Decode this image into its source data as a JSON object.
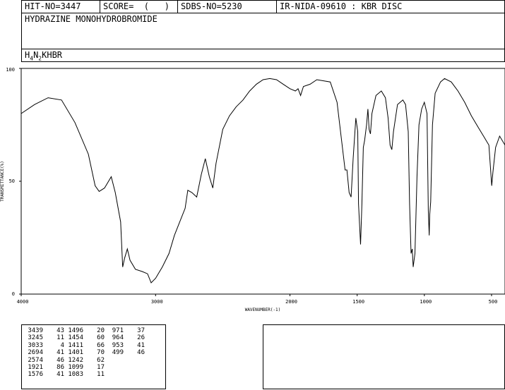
{
  "header": {
    "hit_no": "HIT-NO=3447",
    "score": "SCORE=  (   )",
    "sdbs_no": "SDBS-NO=5230",
    "ir_id": "IR-NIDA-09610 : KBR DISC"
  },
  "compound": {
    "name": "HYDRAZINE MONOHYDROBROMIDE",
    "formula_parts": [
      "H",
      "4",
      "N",
      "2",
      "KHBR"
    ]
  },
  "chart_data": {
    "type": "line",
    "title": "",
    "xlabel": "WAVENUMBER(-1)",
    "ylabel": "TRANSMITTANCE(%)",
    "xlim": [
      4000,
      400
    ],
    "ylim": [
      0,
      100
    ],
    "x_ticks": [
      "4000",
      "3000",
      "2000",
      "1500",
      "1000",
      "500"
    ],
    "x_tick_values": [
      4000,
      3000,
      2000,
      1500,
      1000,
      500
    ],
    "y_ticks": [
      "0",
      "50",
      "100"
    ],
    "y_tick_values": [
      0,
      50,
      100
    ],
    "series": [
      {
        "points": [
          [
            4000,
            80
          ],
          [
            3900,
            84
          ],
          [
            3800,
            87
          ],
          [
            3700,
            86
          ],
          [
            3600,
            76
          ],
          [
            3500,
            62
          ],
          [
            3450,
            48
          ],
          [
            3420,
            45.5
          ],
          [
            3380,
            47
          ],
          [
            3330,
            52
          ],
          [
            3300,
            45
          ],
          [
            3260,
            32
          ],
          [
            3245,
            12
          ],
          [
            3230,
            16
          ],
          [
            3210,
            20
          ],
          [
            3190,
            15
          ],
          [
            3150,
            11
          ],
          [
            3100,
            10
          ],
          [
            3060,
            9
          ],
          [
            3033,
            5
          ],
          [
            3000,
            7
          ],
          [
            2950,
            12
          ],
          [
            2900,
            18
          ],
          [
            2860,
            26
          ],
          [
            2820,
            32
          ],
          [
            2780,
            38
          ],
          [
            2760,
            46
          ],
          [
            2730,
            45
          ],
          [
            2694,
            43
          ],
          [
            2660,
            53
          ],
          [
            2630,
            60
          ],
          [
            2600,
            52
          ],
          [
            2574,
            47
          ],
          [
            2550,
            58
          ],
          [
            2500,
            73
          ],
          [
            2450,
            79
          ],
          [
            2400,
            83
          ],
          [
            2350,
            86
          ],
          [
            2300,
            90
          ],
          [
            2250,
            93
          ],
          [
            2200,
            95
          ],
          [
            2150,
            95.5
          ],
          [
            2100,
            95
          ],
          [
            2050,
            93
          ],
          [
            2000,
            91
          ],
          [
            1960,
            90
          ],
          [
            1940,
            91
          ],
          [
            1921,
            88
          ],
          [
            1900,
            92
          ],
          [
            1850,
            93
          ],
          [
            1800,
            95
          ],
          [
            1750,
            94.5
          ],
          [
            1700,
            94
          ],
          [
            1650,
            85
          ],
          [
            1620,
            70
          ],
          [
            1600,
            60
          ],
          [
            1590,
            55
          ],
          [
            1576,
            55
          ],
          [
            1560,
            45
          ],
          [
            1545,
            43
          ],
          [
            1530,
            60
          ],
          [
            1510,
            78
          ],
          [
            1496,
            72
          ],
          [
            1490,
            40
          ],
          [
            1475,
            22
          ],
          [
            1465,
            40
          ],
          [
            1454,
            65
          ],
          [
            1445,
            68
          ],
          [
            1430,
            75
          ],
          [
            1420,
            82
          ],
          [
            1411,
            73
          ],
          [
            1401,
            71
          ],
          [
            1390,
            80
          ],
          [
            1360,
            88
          ],
          [
            1320,
            90
          ],
          [
            1290,
            87
          ],
          [
            1270,
            78
          ],
          [
            1255,
            66
          ],
          [
            1242,
            64
          ],
          [
            1230,
            72
          ],
          [
            1200,
            84
          ],
          [
            1160,
            86
          ],
          [
            1140,
            84
          ],
          [
            1120,
            72
          ],
          [
            1110,
            40
          ],
          [
            1099,
            18
          ],
          [
            1090,
            20
          ],
          [
            1083,
            12
          ],
          [
            1070,
            18
          ],
          [
            1055,
            52
          ],
          [
            1040,
            75
          ],
          [
            1020,
            82
          ],
          [
            1000,
            85
          ],
          [
            980,
            80
          ],
          [
            971,
            37
          ],
          [
            964,
            26
          ],
          [
            960,
            35
          ],
          [
            953,
            41
          ],
          [
            940,
            75
          ],
          [
            920,
            89
          ],
          [
            880,
            94
          ],
          [
            850,
            95.5
          ],
          [
            800,
            94
          ],
          [
            750,
            90
          ],
          [
            700,
            85
          ],
          [
            650,
            79
          ],
          [
            600,
            74
          ],
          [
            560,
            70
          ],
          [
            520,
            66
          ],
          [
            499,
            48
          ],
          [
            490,
            54
          ],
          [
            470,
            65
          ],
          [
            440,
            70
          ],
          [
            400,
            66
          ]
        ]
      }
    ]
  },
  "peak_table": {
    "columns": [
      [
        "3439",
        "3245",
        "3033",
        "2694",
        "2574",
        "1921",
        "1576"
      ],
      [
        "43",
        "11",
        "4",
        "41",
        "46",
        "86",
        "41"
      ],
      [
        "1496",
        "1454",
        "1411",
        "1401",
        "1242",
        "1099",
        "1083"
      ],
      [
        "20",
        "60",
        "66",
        "70",
        "62",
        "17",
        "11"
      ],
      [
        "971",
        "964",
        "953",
        "499",
        "",
        "",
        ""
      ],
      [
        "37",
        "26",
        "41",
        "46",
        "",
        "",
        ""
      ]
    ]
  }
}
